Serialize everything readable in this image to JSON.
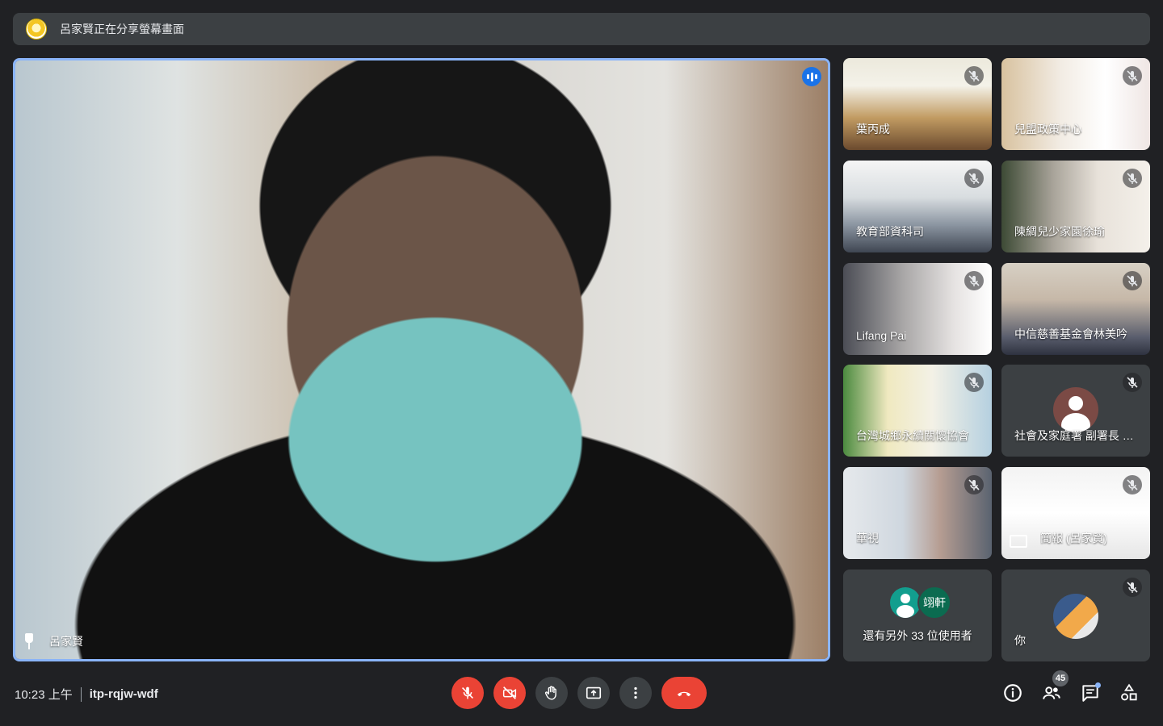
{
  "presenting": {
    "text": "呂家賢正在分享螢幕畫面"
  },
  "main": {
    "name": "呂家賢"
  },
  "tiles": [
    {
      "name": "葉丙成",
      "bg": "linear-gradient(180deg,#ece9dc 0%,#f4f2e9 30%,#c19b62 65%,#6b4a2e 100%)"
    },
    {
      "name": "兒盟政策中心",
      "bg": "linear-gradient(90deg,#d8c29f 0%,#f2ece4 40%,#ffffff 70%,#efe6e4 100%)"
    },
    {
      "name": "教育部資科司",
      "bg": "linear-gradient(180deg,#f5f5f5 0%,#d8dde0 40%,#8b95a1 70%,#3f4652 100%)"
    },
    {
      "name": "陳綢兒少家園徐瑜",
      "bg": "linear-gradient(90deg,#3d4a35 0%,#a9a49a 35%,#e8e2da 65%,#f4f0ea 100%)"
    },
    {
      "name": "Lifang Pai",
      "bg": "linear-gradient(90deg,#4b4d55 0%,#a8a6a6 40%,#e6e3e2 75%,#ffffff 100%)"
    },
    {
      "name": "中信慈善基金會林美吟",
      "bg": "linear-gradient(180deg,#d7d0c4 0%,#c6b8a8 40%,#5b5f6e 80%,#2e3240 100%)"
    },
    {
      "name": "台灣城鄉永續關懷協會",
      "bg": "linear-gradient(90deg,#4b8a3f 0%,#f0e9c0 30%,#f3f1e6 60%,#b5d0e0 100%)"
    },
    {
      "name": "社會及家庭署 副署長 張…",
      "avatar": true
    },
    {
      "name": "華視",
      "bg": "linear-gradient(90deg,#e6e9ec 0%,#cfd7df 40%,#b69d92 65%,#5a6370 100%)"
    },
    {
      "name": "簡報 (呂家賢)",
      "bg": "linear-gradient(180deg,#f3f3f3 0%,#ffffff 50%,#e6e6e6 100%)",
      "present": true
    }
  ],
  "more": {
    "initial": "翊軒",
    "text": "還有另外 33 位使用者"
  },
  "you": {
    "name": "你"
  },
  "bottom": {
    "time": "10:23 上午",
    "code": "itp-rqjw-wdf",
    "participants_count": "45"
  },
  "icons": {
    "mic": "mic-off-icon",
    "camera": "camera-off-icon",
    "hand": "raise-hand-icon",
    "present": "present-screen-icon",
    "more": "more-options-icon",
    "hangup": "hang-up-icon",
    "info": "info-icon",
    "people": "people-icon",
    "chat": "chat-icon",
    "activities": "activities-icon"
  },
  "colors": {
    "background": "#202124",
    "tile": "#3c4043",
    "accent": "#8ab4f8",
    "danger": "#ea4335",
    "speaking": "#1a73e8"
  }
}
